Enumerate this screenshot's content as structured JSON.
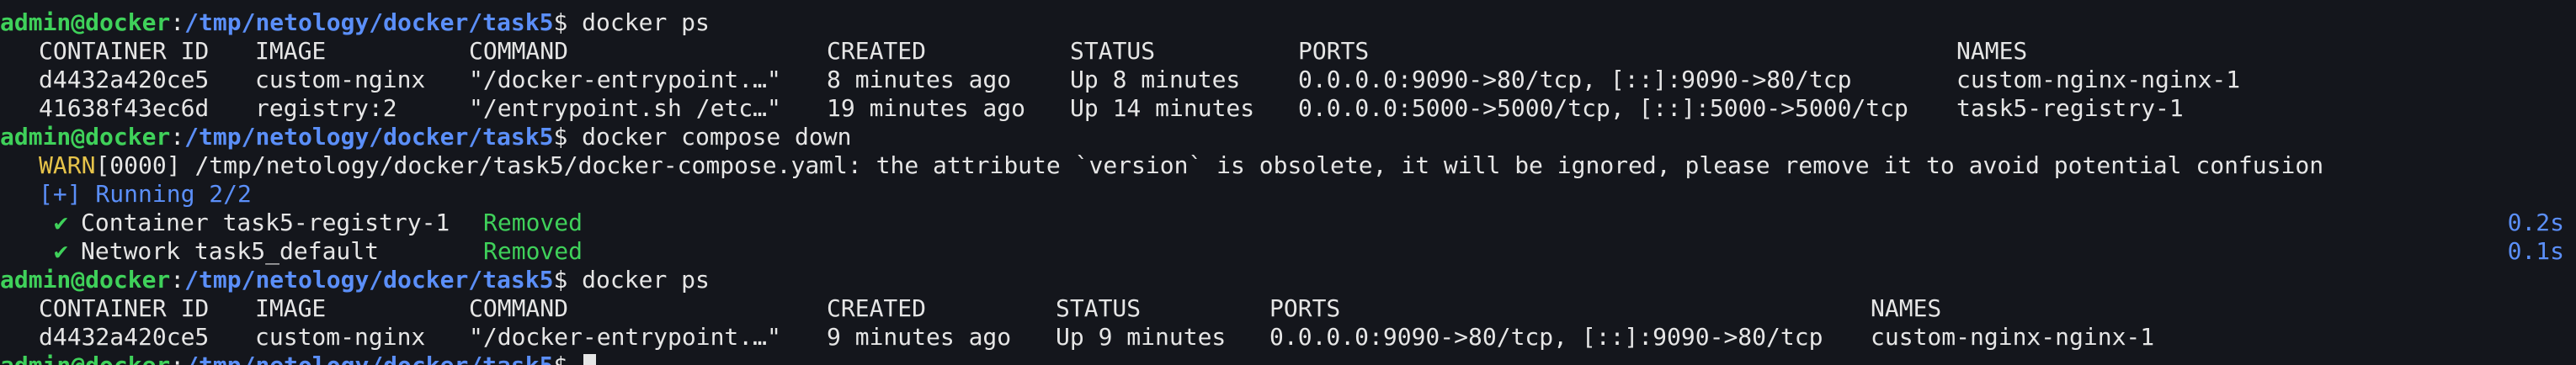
{
  "terminal": {
    "prompt": {
      "user_host": "admin@docker",
      "separator": ":",
      "path": "/tmp/netology/docker/task5",
      "symbol": "$ "
    },
    "commands": {
      "ps": "docker ps",
      "compose_down": "docker compose down"
    },
    "table1": {
      "headers": [
        "CONTAINER ID",
        "IMAGE",
        "COMMAND",
        "CREATED",
        "STATUS",
        "PORTS",
        "NAMES"
      ],
      "rows": [
        [
          "d4432a420ce5",
          "custom-nginx",
          "\"/docker-entrypoint.…\"",
          "8 minutes ago",
          "Up 8 minutes",
          "0.0.0.0:9090->80/tcp, [::]:9090->80/tcp",
          "custom-nginx-nginx-1"
        ],
        [
          "41638f43ec6d",
          "registry:2",
          "\"/entrypoint.sh /etc…\"",
          "19 minutes ago",
          "Up 14 minutes",
          "0.0.0.0:5000->5000/tcp, [::]:5000->5000/tcp",
          "task5-registry-1"
        ]
      ]
    },
    "warn": {
      "tag": "WARN",
      "code": "[0000]",
      "message": " /tmp/netology/docker/task5/docker-compose.yaml: the attribute `version` is obsolete, it will be ignored, please remove it to avoid potential confusion"
    },
    "running": "[+] Running 2/2",
    "removals": [
      {
        "check": "✔",
        "label": "Container task5-registry-1",
        "status": "Removed",
        "time": "0.2s"
      },
      {
        "check": "✔",
        "label": "Network task5_default",
        "status": "Removed",
        "time": "0.1s"
      }
    ],
    "table2": {
      "headers": [
        "CONTAINER ID",
        "IMAGE",
        "COMMAND",
        "CREATED",
        "STATUS",
        "PORTS",
        "NAMES"
      ],
      "rows": [
        [
          "d4432a420ce5",
          "custom-nginx",
          "\"/docker-entrypoint.…\"",
          "9 minutes ago",
          "Up 9 minutes",
          "0.0.0.0:9090->80/tcp, [::]:9090->80/tcp",
          "custom-nginx-nginx-1"
        ]
      ]
    }
  }
}
